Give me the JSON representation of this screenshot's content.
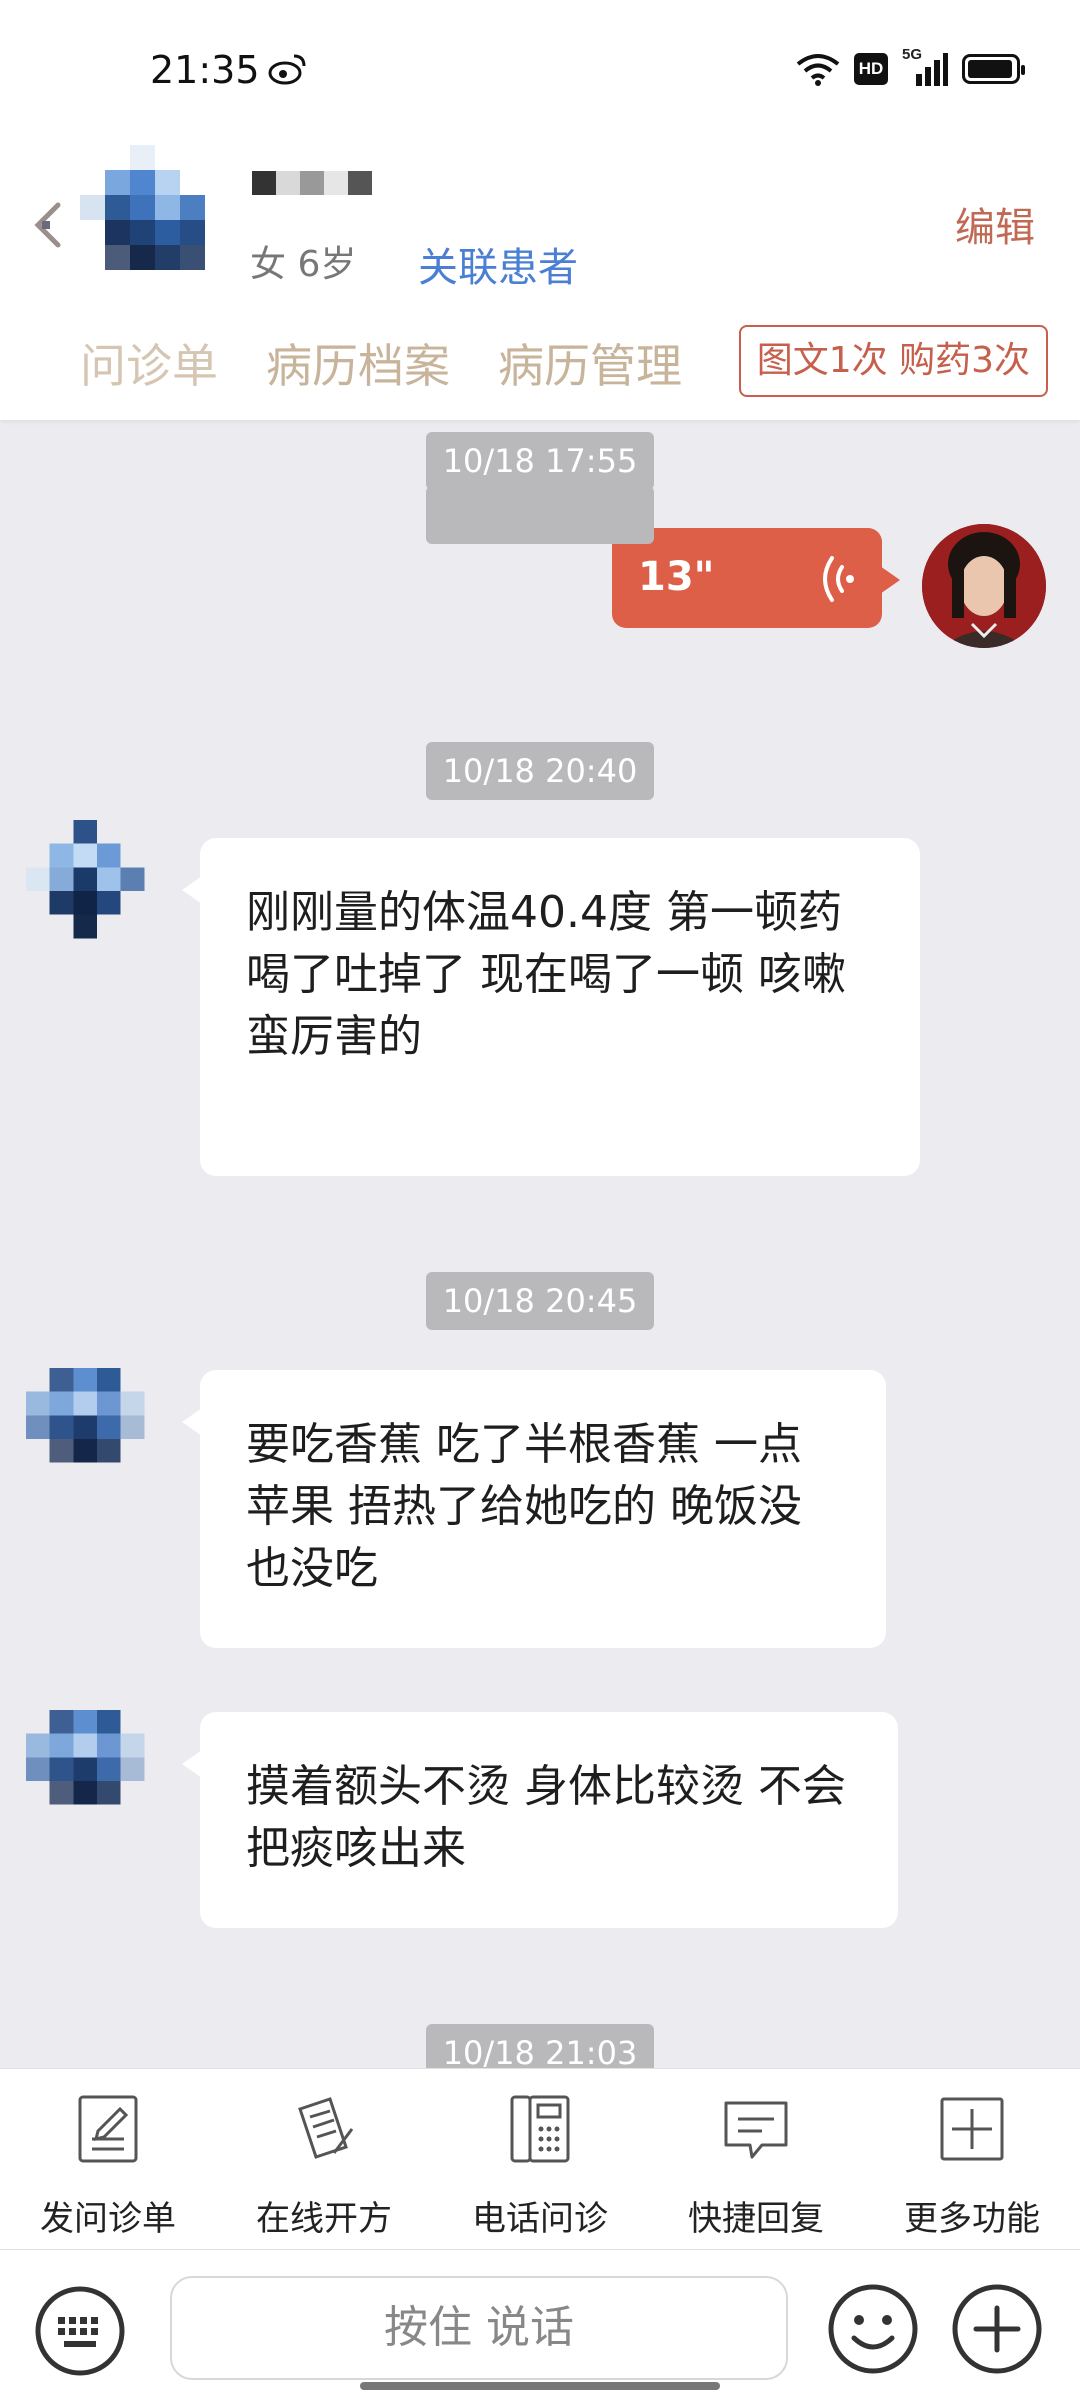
{
  "status_bar": {
    "time": "21:35",
    "network": "5G",
    "hd_label": "HD",
    "icons": [
      "weibo-icon",
      "wifi-icon",
      "hd-icon",
      "signal-icon",
      "battery-icon"
    ]
  },
  "header": {
    "patient": {
      "gender_age": "女 6岁",
      "link_label": "关联患者"
    },
    "edit_label": "编辑",
    "tabs": [
      {
        "label": "问诊单"
      },
      {
        "label": "病历档案"
      },
      {
        "label": "病历管理"
      }
    ],
    "badge_label": "图文1次 购药3次"
  },
  "chat": {
    "messages": [
      {
        "time": "10/18 17:55",
        "type": "voice",
        "duration": "13\"",
        "from": "doctor"
      },
      {
        "time": "10/18 20:40",
        "type": "text",
        "from": "patient",
        "text": "刚刚量的体温40.4度 第一顿药喝了吐掉了 现在喝了一顿 咳嗽蛮厉害的"
      },
      {
        "time": "10/18 20:45",
        "type": "text",
        "from": "patient",
        "text": "要吃香蕉 吃了半根香蕉 一点苹果 捂热了给她吃的 晚饭没也没吃"
      },
      {
        "type": "text",
        "from": "patient",
        "text": "摸着额头不烫 身体比较烫 不会把痰咳出来"
      },
      {
        "time": "10/18 21:03"
      }
    ]
  },
  "toolbar": {
    "items": [
      {
        "label": "发问诊单",
        "icon": "form-icon"
      },
      {
        "label": "在线开方",
        "icon": "prescription-icon"
      },
      {
        "label": "电话问诊",
        "icon": "phone-icon"
      },
      {
        "label": "快捷回复",
        "icon": "quick-reply-icon"
      },
      {
        "label": "更多功能",
        "icon": "more-icon"
      }
    ]
  },
  "input_bar": {
    "hold_to_talk_label": "按住 说话"
  },
  "colors": {
    "accent_red": "#dd5f48",
    "link_blue": "#4a7fd3",
    "tab_beige": "#c8b49a",
    "chat_bg": "#ececf0"
  }
}
